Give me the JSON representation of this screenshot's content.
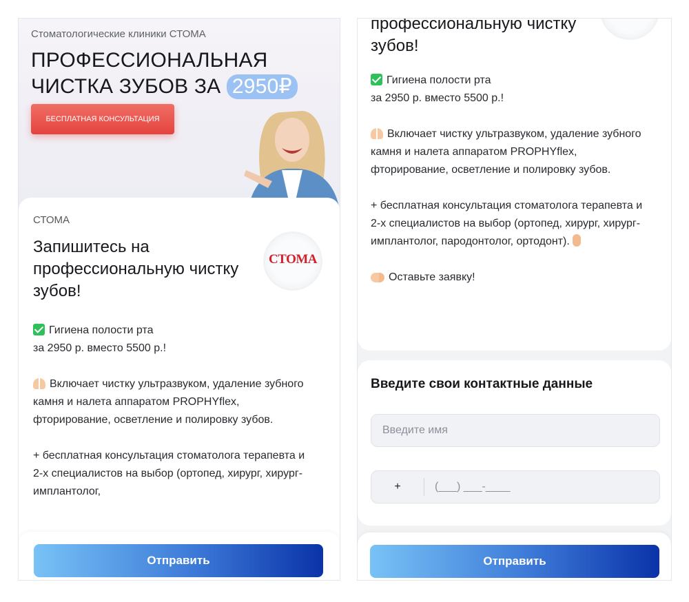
{
  "left": {
    "banner": {
      "subtitle": "Стоматологические клиники СТОМА",
      "title_line1": "ПРОФЕССИОНАЛЬНАЯ",
      "title_line2": "ЧИСТКА ЗУБОВ ЗА",
      "price": "2950₽",
      "cta_label": "БЕСПЛАТНАЯ КОНСУЛЬТАЦИЯ"
    },
    "card": {
      "brand": "СТОМА",
      "title": "Запишитесь на профессиональную чистку зубов!",
      "logo_text": "СТОМА",
      "p1_line1": "Гигиена полости рта",
      "p1_line2": "за 2950 р. вместо 5500 р.!",
      "p2": "Включает чистку ультразвуком, удаление зубного камня и налета аппаратом PROPHYflex, фторирование, осветление и полировку зубов.",
      "p3": "+ бесплатная консультация стоматолога терапевта и 2-х специалистов на выбор (ортопед, хирург, хирург- имплантолог,"
    },
    "submit_label": "Отправить"
  },
  "right": {
    "card": {
      "title_partial": "профессиональную чистку зубов!",
      "p1_line1": "Гигиена полости рта",
      "p1_line2": "за 2950 р. вместо 5500 р.!",
      "p2": "Включает чистку ультразвуком, удаление зубного камня и налета аппаратом PROPHYflex, фторирование, осветление и полировку зубов.",
      "p3": "+ бесплатная консультация стоматолога терапевта и 2-х специалистов на выбор (ортопед, хирург, хирург- имплантолог, пародонтолог, ортодонт).",
      "p4": "Оставьте заявку!"
    },
    "contact": {
      "title": "Введите свои контактные данные",
      "name_placeholder": "Введите имя",
      "phone_code": "+",
      "phone_mask": "(___) ___-____"
    },
    "submit_label": "Отправить"
  },
  "colors": {
    "accent_red": "#e4433d",
    "price_pill": "#9cc2f3",
    "button_gradient_start": "#78c2f6",
    "button_gradient_end": "#0a33a8",
    "check_green": "#2fbf5b"
  },
  "icons": [
    "check-emoji-icon",
    "raised-hands-emoji-icon",
    "thumbs-up-emoji-icon",
    "pointing-hand-emoji-icon"
  ]
}
